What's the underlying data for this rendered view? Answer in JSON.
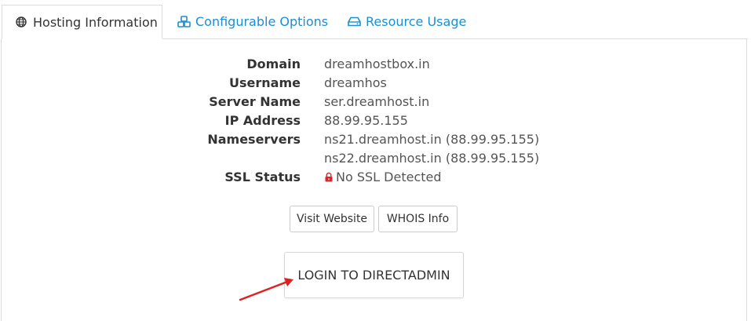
{
  "tabs": [
    {
      "label": "Hosting Information",
      "icon": "globe-icon",
      "active": true
    },
    {
      "label": "Configurable Options",
      "icon": "cubes-icon",
      "active": false
    },
    {
      "label": "Resource Usage",
      "icon": "hdd-icon",
      "active": false
    }
  ],
  "info": {
    "domain": {
      "label": "Domain",
      "value": "dreamhostbox.in"
    },
    "username": {
      "label": "Username",
      "value": "dreamhos"
    },
    "server_name": {
      "label": "Server Name",
      "value": "ser.dreamhost.in"
    },
    "ip_address": {
      "label": "IP Address",
      "value": "88.99.95.155"
    },
    "nameservers": {
      "label": "Nameservers",
      "values": [
        "ns21.dreamhost.in (88.99.95.155)",
        "ns22.dreamhost.in (88.99.95.155)"
      ]
    },
    "ssl_status": {
      "label": "SSL Status",
      "value": "No SSL Detected",
      "icon": "lock-icon"
    }
  },
  "buttons": {
    "visit_website": "Visit Website",
    "whois_info": "WHOIS Info",
    "login": "LOGIN TO DIRECTADMIN"
  },
  "colors": {
    "link": "#1a8fd6",
    "arrow": "#e02020",
    "lock": "#d9262c"
  }
}
